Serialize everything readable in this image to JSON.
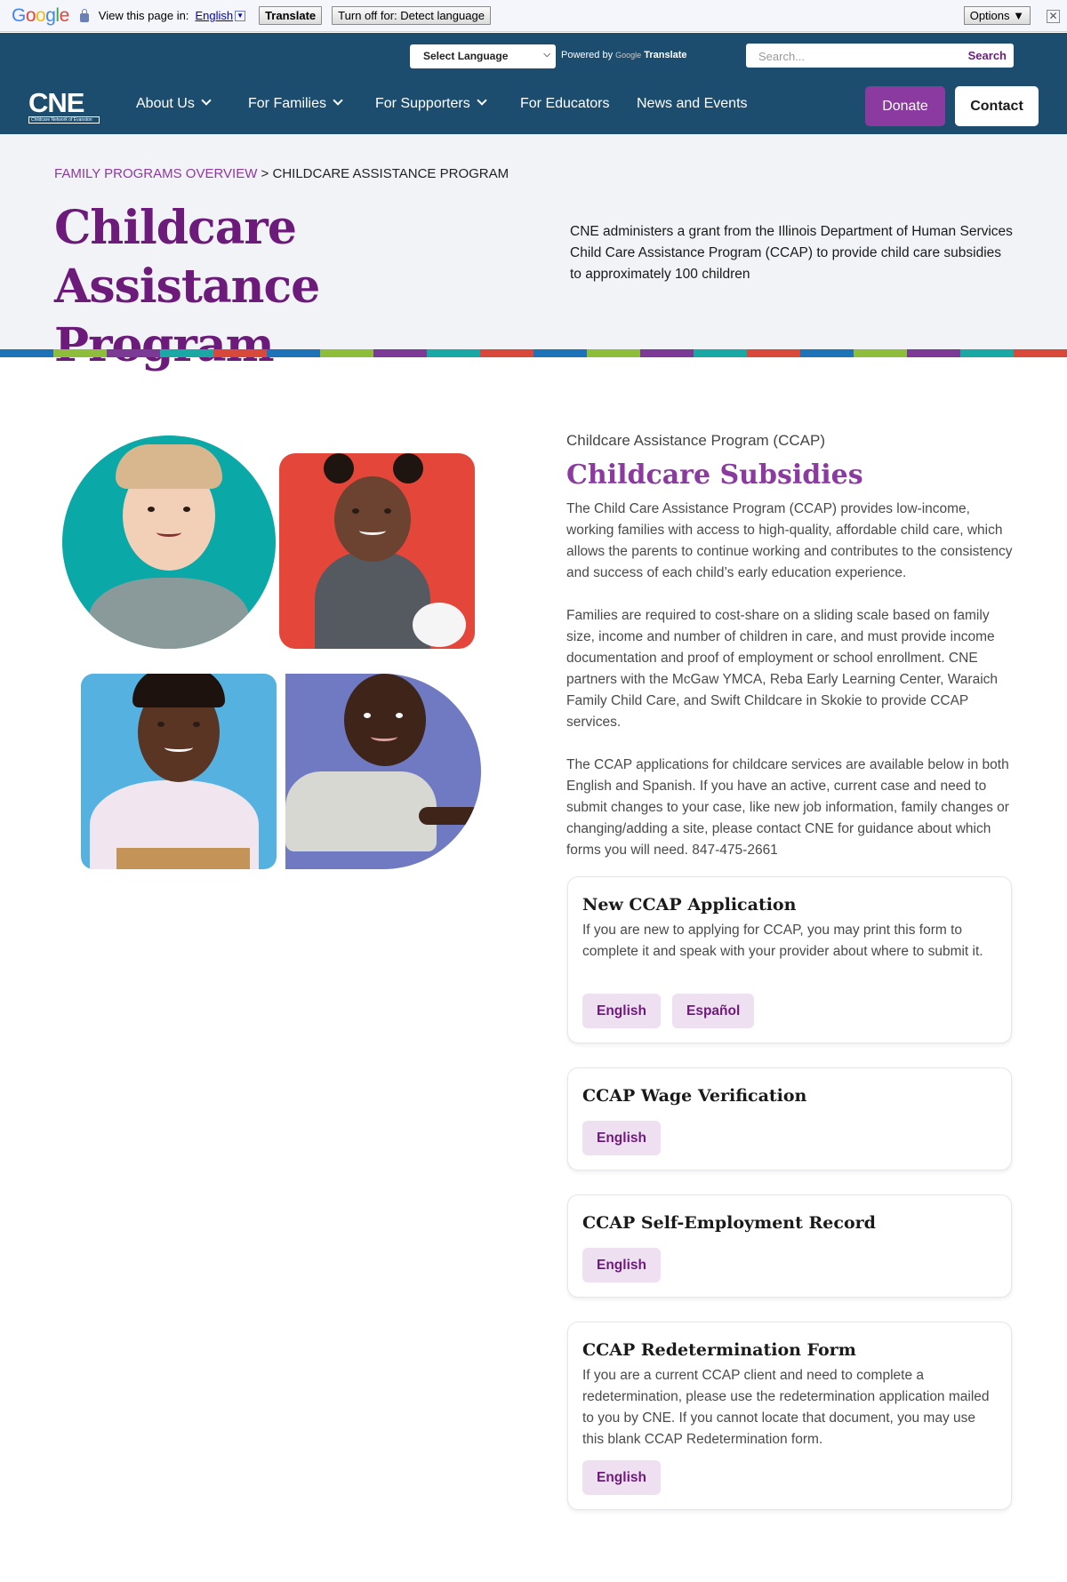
{
  "translate_bar": {
    "prompt": "View this page in:",
    "language_link": "English",
    "translate_button": "Translate",
    "turn_off_button": "Turn off for: Detect language",
    "options_button": "Options ▼",
    "close_glyph": "✕"
  },
  "utility": {
    "language_select": "Select Language",
    "powered_by": "Powered by",
    "google_small": "Google",
    "translate_label": "Translate",
    "search_placeholder": "Search...",
    "search_button": "Search"
  },
  "nav": {
    "logo_text": "CNE",
    "logo_subtext": "Childcare Network of Evanston",
    "items": [
      {
        "label": "About Us"
      },
      {
        "label": "For Families"
      },
      {
        "label": "For Supporters"
      },
      {
        "label": "For Educators"
      },
      {
        "label": "News and Events"
      }
    ],
    "donate": "Donate",
    "contact": "Contact"
  },
  "hero": {
    "breadcrumb_link": "FAMILY PROGRAMS OVERVIEW",
    "breadcrumb_sep": " > ",
    "breadcrumb_current": "CHILDCARE ASSISTANCE PROGRAM",
    "title": "Childcare Assistance Program",
    "description": "CNE administers a grant from the Illinois Department of Human Services Child Care Assistance Program (CCAP) to provide child care subsidies to approximately 100 children"
  },
  "stripe_colors": [
    "#1e73b8",
    "#8dbd3b",
    "#7b3a96",
    "#19a8a3",
    "#d9493a"
  ],
  "content": {
    "eyebrow": "Childcare Assistance Program (CCAP)",
    "heading": "Childcare Subsidies",
    "paragraphs": [
      "The Child Care Assistance Program (CCAP) provides low-income, working families with access to high-quality, affordable child care, which allows the parents to continue working and contributes to the consistency and success of each child’s early education experience.",
      "Families are required to cost-share on a sliding scale based on family size, income and number of children in care, and must provide income documentation and proof of employment or school enrollment. CNE partners with the McGaw YMCA, Reba Early Learning Center, Waraich Family Child Care, and Swift Childcare in Skokie to provide CCAP services.",
      "The CCAP applications for childcare services are available below in both English and Spanish. If you have an active, current case and need to submit changes to your case, like new job information, family changes or changing/adding a site, please contact CNE for guidance about which forms you will need. 847-475-2661"
    ]
  },
  "cards": [
    {
      "title": "New CCAP Application",
      "description": "If you are new to applying for CCAP, you may print this form to complete it and speak with your provider about where to submit it.",
      "buttons": [
        "English",
        "Español"
      ]
    },
    {
      "title": "CCAP Wage Verification",
      "description": "",
      "buttons": [
        "English"
      ]
    },
    {
      "title": "CCAP Self-Employment Record",
      "description": "",
      "buttons": [
        "English"
      ]
    },
    {
      "title": "CCAP Redetermination Form",
      "description": "If you are a current CCAP client and need to complete a redetermination, please use the redetermination application mailed to you by CNE. If you cannot locate that document, you may use this blank CCAP Redetermination form.",
      "buttons": [
        "English"
      ]
    }
  ],
  "colors": {
    "brand_navy": "#1c4d6f",
    "brand_purple": "#6d1b7b",
    "accent_purple": "#8b3aa0",
    "pill_bg": "#efe0f1"
  }
}
